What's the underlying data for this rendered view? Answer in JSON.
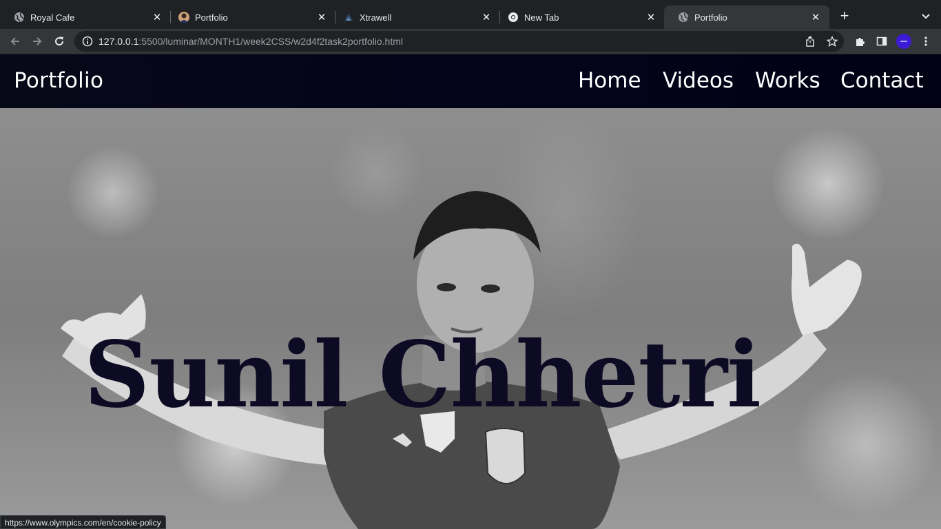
{
  "browser": {
    "tabs": [
      {
        "title": "Royal Cafe",
        "favicon": "globe-icon",
        "active": false
      },
      {
        "title": "Portfolio",
        "favicon": "avatar-icon",
        "active": false
      },
      {
        "title": "Xtrawell",
        "favicon": "xtrawell-icon",
        "active": false
      },
      {
        "title": "New Tab",
        "favicon": "chrome-icon",
        "active": false
      },
      {
        "title": "Portfolio",
        "favicon": "globe-icon",
        "active": true
      }
    ],
    "url_host": "127.0.0.1",
    "url_rest": ":5500/luminar/MONTH1/week2CSS/w2d4f2task2portfolio.html",
    "status_url": "https://www.olympics.com/en/cookie-policy"
  },
  "site": {
    "brand": "Portfolio",
    "nav": [
      "Home",
      "Videos",
      "Works",
      "Contact"
    ],
    "hero_name": "Sunil Chhetri"
  },
  "colors": {
    "nav_bg": "#03031a",
    "hero_text": "#0d0a24",
    "chrome_bg": "#202124",
    "toolbar_bg": "#35363a"
  }
}
